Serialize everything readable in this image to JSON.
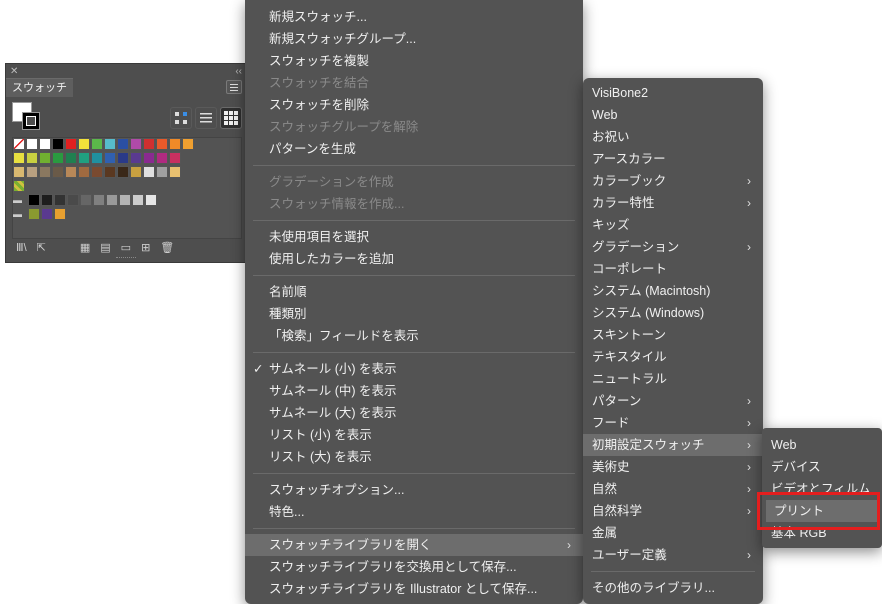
{
  "panel": {
    "title": "スウォッチ",
    "close_glyph": "✕",
    "collapse_glyph": "‹‹",
    "swatch_rows": [
      [
        "none",
        "#ffffff",
        "#ffffff",
        "#000000",
        "#e02020",
        "#f2e23a",
        "#5bb84a",
        "#57bccb",
        "#2a4fa3",
        "#b04aa8",
        "#d03030",
        "#e85a2a",
        "#f08a28",
        "#f0a030"
      ],
      [
        "#e8e040",
        "#c8d040",
        "#70b030",
        "#2a9a40",
        "#208050",
        "#20a080",
        "#2090a0",
        "#3060b0",
        "#2a3a88",
        "#5a3a90",
        "#8a2a90",
        "#b02a80",
        "#c83060"
      ],
      [
        "#d8b870",
        "#b8a080",
        "#8a7860",
        "#6a5a48",
        "#b88858",
        "#a06a40",
        "#7a4a30",
        "#5a3820",
        "#3a2818",
        "#c8a040",
        "#e0e0e0",
        "#a0a0a0",
        "#e8c070"
      ],
      [
        "pattern"
      ],
      [
        "folder",
        "#000000",
        "#1e1e1e",
        "#333333",
        "#4a4a4a",
        "#666666",
        "#808080",
        "#999999",
        "#b3b3b3",
        "#cccccc",
        "#e6e6e6"
      ],
      [
        "folder",
        "#8a9a30",
        "#5a3a90",
        "#e8a030"
      ]
    ]
  },
  "menu1": {
    "items": [
      {
        "label": "新規スウォッチ...",
        "state": "enabled"
      },
      {
        "label": "新規スウォッチグループ...",
        "state": "enabled"
      },
      {
        "label": "スウォッチを複製",
        "state": "enabled"
      },
      {
        "label": "スウォッチを結合",
        "state": "disabled"
      },
      {
        "label": "スウォッチを削除",
        "state": "enabled"
      },
      {
        "label": "スウォッチグループを解除",
        "state": "disabled"
      },
      {
        "label": "パターンを生成",
        "state": "enabled"
      },
      {
        "sep": true
      },
      {
        "label": "グラデーションを作成",
        "state": "disabled"
      },
      {
        "label": "スウォッチ情報を作成...",
        "state": "disabled"
      },
      {
        "sep": true
      },
      {
        "label": "未使用項目を選択",
        "state": "enabled"
      },
      {
        "label": "使用したカラーを追加",
        "state": "enabled"
      },
      {
        "sep": true
      },
      {
        "label": "名前順",
        "state": "enabled"
      },
      {
        "label": "種類別",
        "state": "enabled"
      },
      {
        "label": "「検索」フィールドを表示",
        "state": "enabled"
      },
      {
        "sep": true
      },
      {
        "label": "サムネール (小) を表示",
        "state": "enabled",
        "checked": true
      },
      {
        "label": "サムネール (中) を表示",
        "state": "enabled"
      },
      {
        "label": "サムネール (大) を表示",
        "state": "enabled"
      },
      {
        "label": "リスト (小) を表示",
        "state": "enabled"
      },
      {
        "label": "リスト (大) を表示",
        "state": "enabled"
      },
      {
        "sep": true
      },
      {
        "label": "スウォッチオプション...",
        "state": "enabled"
      },
      {
        "label": "特色...",
        "state": "enabled"
      },
      {
        "sep": true
      },
      {
        "label": "スウォッチライブラリを開く",
        "state": "enabled",
        "submenu": true,
        "highlight": true
      },
      {
        "label": "スウォッチライブラリを交換用として保存...",
        "state": "enabled"
      },
      {
        "label": "スウォッチライブラリを Illustrator として保存...",
        "state": "enabled"
      }
    ]
  },
  "menu2": {
    "items": [
      {
        "label": "VisiBone2"
      },
      {
        "label": "Web"
      },
      {
        "label": "お祝い"
      },
      {
        "label": "アースカラー"
      },
      {
        "label": "カラーブック",
        "submenu": true
      },
      {
        "label": "カラー特性",
        "submenu": true
      },
      {
        "label": "キッズ"
      },
      {
        "label": "グラデーション",
        "submenu": true
      },
      {
        "label": "コーポレート"
      },
      {
        "label": "システム (Macintosh)"
      },
      {
        "label": "システム (Windows)"
      },
      {
        "label": "スキントーン"
      },
      {
        "label": "テキスタイル"
      },
      {
        "label": "ニュートラル"
      },
      {
        "label": "パターン",
        "submenu": true
      },
      {
        "label": "フード",
        "submenu": true
      },
      {
        "label": "初期設定スウォッチ",
        "submenu": true,
        "highlight": true
      },
      {
        "label": "美術史",
        "submenu": true
      },
      {
        "label": "自然",
        "submenu": true
      },
      {
        "label": "自然科学",
        "submenu": true
      },
      {
        "label": "金属"
      },
      {
        "label": "ユーザー定義",
        "submenu": true
      },
      {
        "sep": true
      },
      {
        "label": "その他のライブラリ..."
      }
    ]
  },
  "menu3": {
    "items": [
      {
        "label": "Web"
      },
      {
        "label": "デバイス"
      },
      {
        "label": "ビデオとフィルム"
      },
      {
        "label": "プリント",
        "highlight": true
      },
      {
        "label": "基本 RGB"
      }
    ]
  },
  "glyphs": {
    "chevron": "›",
    "check": "✓"
  },
  "colors": {
    "menu_bg": "#535353",
    "highlight": "#6d6d6d",
    "callout": "#e41e1e",
    "panel_bg": "#4e4e4e"
  }
}
